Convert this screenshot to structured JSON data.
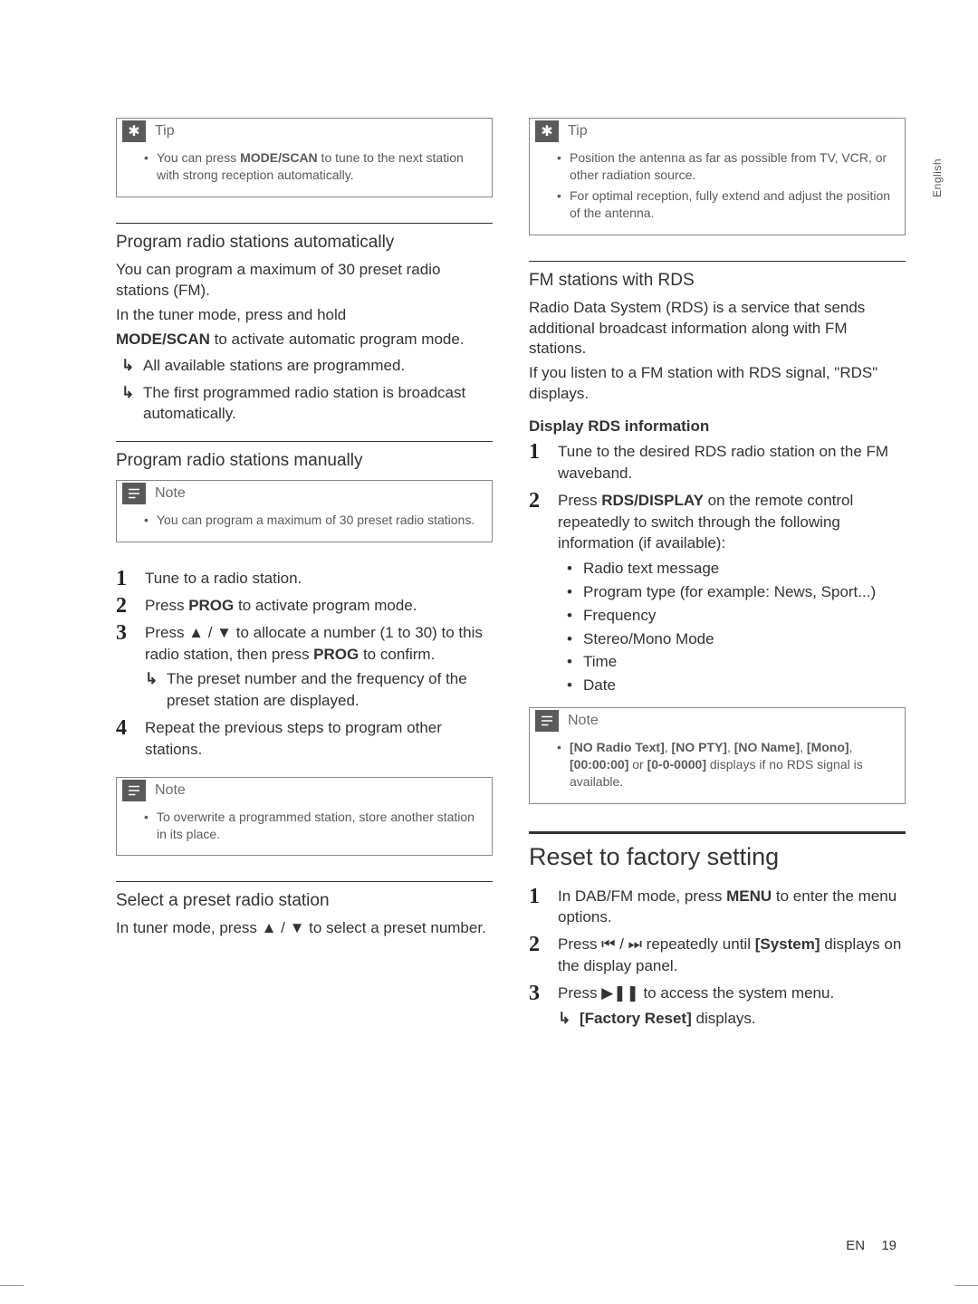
{
  "side_tab": "English",
  "footer": {
    "lang": "EN",
    "page": "19"
  },
  "glyphs": {
    "up": "▲",
    "down": "▼",
    "prev": "⏮",
    "next": "⏭",
    "playpause": "▶❚❚"
  },
  "left": {
    "tip": {
      "label": "Tip",
      "items": [
        "You can press <b>MODE/SCAN</b> to tune to the next station with strong reception automatically."
      ]
    },
    "sec1": {
      "heading": "Program radio stations automatically",
      "p1": "You can program a maximum of 30 preset radio stations (FM).",
      "p2": "In the tuner mode, press and hold",
      "p3": "<b>MODE/SCAN</b> to activate automatic program mode.",
      "results": [
        "All available stations are programmed.",
        "The first programmed radio station is broadcast automatically."
      ]
    },
    "sec2": {
      "heading": "Program radio stations manually",
      "note": {
        "label": "Note",
        "items": [
          "You can program a maximum of 30 preset radio stations."
        ]
      },
      "steps": [
        {
          "text": "Tune to a radio station."
        },
        {
          "text": "Press <b>PROG</b> to activate program mode."
        },
        {
          "text": "Press ▲ / ▼ to allocate a number (1 to 30) to this radio station, then press <b>PROG</b> to confirm.",
          "result": [
            "The preset number and the frequency of the preset station are displayed."
          ]
        },
        {
          "text": "Repeat the previous steps to program other stations."
        }
      ],
      "note2": {
        "label": "Note",
        "items": [
          "To overwrite a programmed station, store another station in its place."
        ]
      }
    },
    "sec3": {
      "heading": "Select a preset radio station",
      "p1": "In tuner mode, press ▲ / ▼ to select a preset number."
    }
  },
  "right": {
    "tip": {
      "label": "Tip",
      "items": [
        "Position the antenna as far as possible from TV, VCR, or other radiation source.",
        "For optimal reception, fully extend and adjust the position of the antenna."
      ]
    },
    "sec1": {
      "heading": "FM stations with RDS",
      "p1": "Radio Data System (RDS) is a service that sends additional broadcast information along with FM stations.",
      "p2": "If you listen to a FM station with RDS signal, \"RDS\" displays.",
      "sub": "Display RDS information",
      "steps": [
        {
          "text": "Tune to the desired RDS radio station on the FM waveband."
        },
        {
          "text": "Press <b>RDS/DISPLAY</b> on the remote control repeatedly to switch through the following information (if available):",
          "bullets": [
            "Radio text message",
            "Program type (for example: News, Sport...)",
            "Frequency",
            "Stereo/Mono Mode",
            "Time",
            "Date"
          ]
        }
      ],
      "note": {
        "label": "Note",
        "items": [
          "<b>[NO Radio Text]</b>, <b>[NO PTY]</b>, <b>[NO Name]</b>, <b>[Mono]</b>, <b>[00:00:00]</b> or <b>[0-0-0000]</b> displays if no RDS signal is available."
        ]
      }
    },
    "sec2": {
      "heading": "Reset to factory setting",
      "steps": [
        {
          "text": "In DAB/FM mode, press <b>MENU</b> to enter the menu options."
        },
        {
          "text": "Press ⏮ / ⏭ repeatedly until <b>[System]</b> displays on the display panel."
        },
        {
          "text": "Press ▶❚❚ to access the system menu.",
          "result": [
            "<b>[Factory Reset]</b> displays."
          ]
        }
      ]
    }
  }
}
